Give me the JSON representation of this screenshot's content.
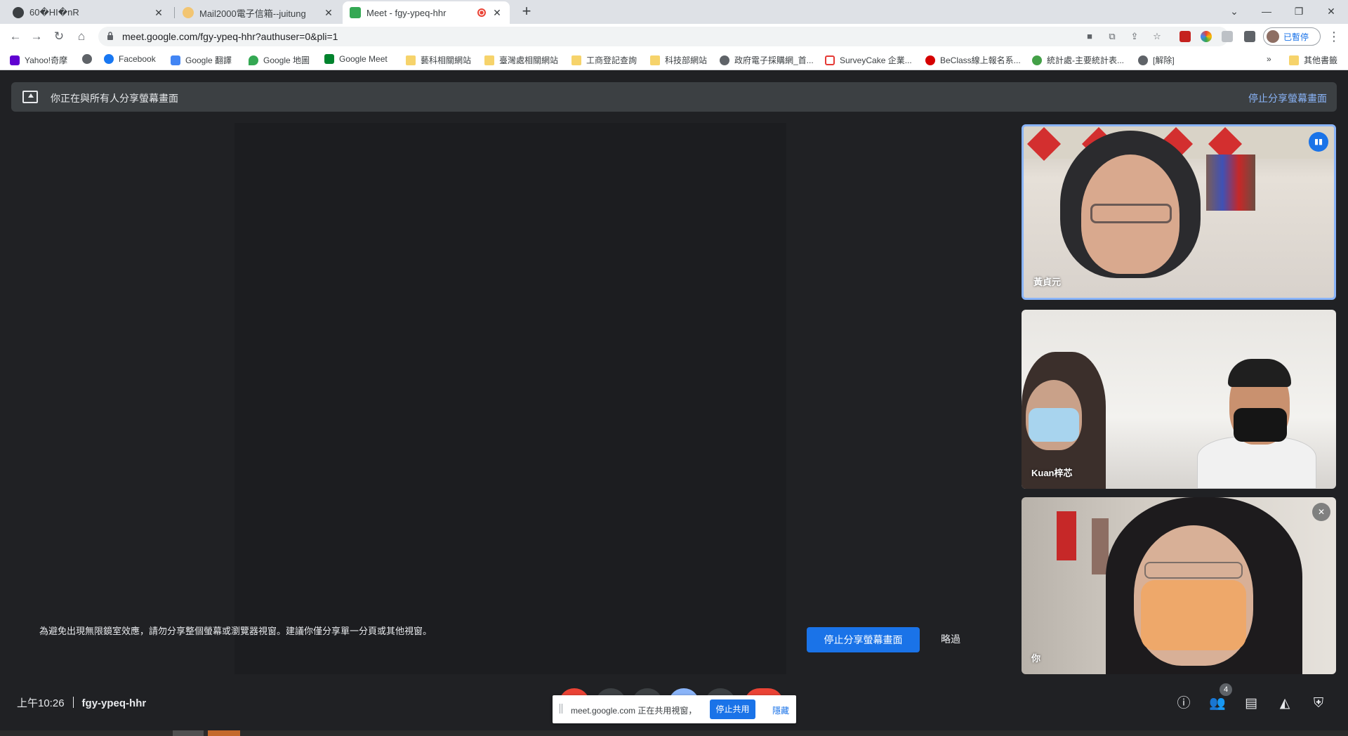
{
  "browser": {
    "tabs": [
      {
        "title": "60�HI�nR",
        "favicon": "globe-icon"
      },
      {
        "title": "Mail2000電子信箱--juitung",
        "favicon": "mail-icon"
      },
      {
        "title": "Meet - fgy-ypeq-hhr",
        "favicon": "meet-icon",
        "active": true,
        "recording": true
      }
    ],
    "url": "meet.google.com/fgy-ypeq-hhr?authuser=0&pli=1",
    "profile_label": "已暫停",
    "bookmarks": [
      {
        "label": "Yahoo!奇摩",
        "icon": "yahoo-icon"
      },
      {
        "label": "",
        "icon": "globe-icon"
      },
      {
        "label": "Facebook",
        "icon": "facebook-icon"
      },
      {
        "label": "Google 翻譯",
        "icon": "translate-icon"
      },
      {
        "label": "Google 地圖",
        "icon": "maps-icon"
      },
      {
        "label": "Google Meet",
        "icon": "meet-icon"
      },
      {
        "label": "藝科相關網站",
        "icon": "folder-icon"
      },
      {
        "label": "臺灣處相關網站",
        "icon": "folder-icon"
      },
      {
        "label": "工商登記查詢",
        "icon": "folder-icon"
      },
      {
        "label": "科技部網站",
        "icon": "folder-icon"
      },
      {
        "label": "政府電子採購網_首...",
        "icon": "globe-icon"
      },
      {
        "label": "SurveyCake 企業...",
        "icon": "surveycake-icon"
      },
      {
        "label": "BeClass線上報名系...",
        "icon": "beclass-icon"
      },
      {
        "label": "統計處-主要統計表...",
        "icon": "stats-icon"
      },
      {
        "label": "[解除]",
        "icon": "globe-icon"
      }
    ],
    "bookmarks_overflow": "»",
    "other_bookmarks": "其他書籤"
  },
  "meet": {
    "banner_text": "你正在與所有人分享螢幕畫面",
    "banner_stop": "停止分享螢幕畫面",
    "warning_text": "為避免出現無限鏡室效應，請勿分享整個螢幕或瀏覽器視窗。建議你僅分享單一分頁或其他視窗。",
    "warning_stop_button": "停止分享螢幕畫面",
    "warning_skip": "略過",
    "participants": [
      {
        "name": "黃貞元",
        "speaking": true
      },
      {
        "name": "Kuan梓芯"
      },
      {
        "name": "你",
        "muted": true
      }
    ],
    "time": "上午10:26",
    "meeting_code": "fgy-ypeq-hhr",
    "participant_count": "4",
    "share_popup": {
      "text": "meet.google.com 正在共用視窗，",
      "stop": "停止共用",
      "hide": "隱藏"
    }
  },
  "colors": {
    "accent": "#1a73e8",
    "banner_bg": "#3c4043",
    "page_bg": "#202124",
    "end_call": "#ea4335"
  }
}
